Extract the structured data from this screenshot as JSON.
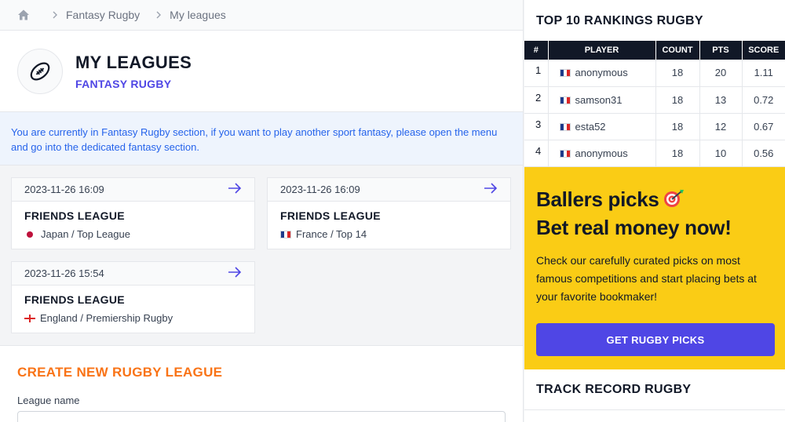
{
  "breadcrumb": {
    "items": [
      "Fantasy Rugby",
      "My leagues"
    ]
  },
  "header": {
    "title": "MY LEAGUES",
    "subtitle": "FANTASY RUGBY"
  },
  "notice": {
    "text": "You are currently in Fantasy Rugby section, if you want to play another sport fantasy, please open the menu and go into the dedicated fantasy section."
  },
  "leagues": [
    {
      "date": "2023-11-26 16:09",
      "name": "FRIENDS LEAGUE",
      "competition": "Japan / Top League",
      "flag": "japan"
    },
    {
      "date": "2023-11-26 16:09",
      "name": "FRIENDS LEAGUE",
      "competition": "France / Top 14",
      "flag": "france"
    },
    {
      "date": "2023-11-26 15:54",
      "name": "FRIENDS LEAGUE",
      "competition": "England / Premiership Rugby",
      "flag": "england"
    }
  ],
  "create": {
    "title": "CREATE NEW RUGBY LEAGUE",
    "label": "League name"
  },
  "rankings": {
    "title": "TOP 10 RANKINGS RUGBY",
    "columns": [
      "#",
      "PLAYER",
      "COUNT",
      "PTS",
      "SCORE"
    ],
    "rows": [
      {
        "pos": "1",
        "player": "anonymous",
        "count": "18",
        "pts": "20",
        "score": "1.11"
      },
      {
        "pos": "2",
        "player": "samson31",
        "count": "18",
        "pts": "13",
        "score": "0.72"
      },
      {
        "pos": "3",
        "player": "esta52",
        "count": "18",
        "pts": "12",
        "score": "0.67"
      },
      {
        "pos": "4",
        "player": "anonymous",
        "count": "18",
        "pts": "10",
        "score": "0.56"
      }
    ]
  },
  "promo": {
    "line1": "Ballers picks",
    "line2": "Bet real money now!",
    "text": "Check our carefully curated picks on most famous competitions and start placing bets at your favorite bookmaker!",
    "button": "GET RUGBY PICKS"
  },
  "track": {
    "title": "TRACK RECORD RUGBY"
  },
  "colors": {
    "accent": "#4f46e5",
    "promo_bg": "#facc15",
    "create_title": "#f97316",
    "notice_text": "#2563eb"
  }
}
